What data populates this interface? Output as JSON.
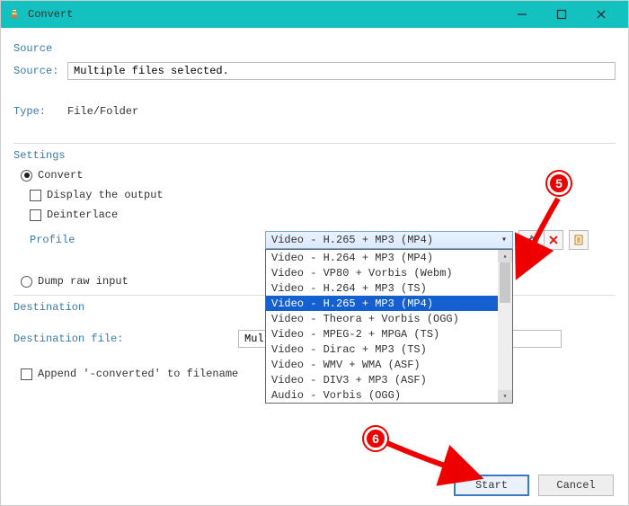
{
  "window": {
    "title": "Convert",
    "min": "—",
    "max": "□",
    "close": "✕"
  },
  "source": {
    "legend": "Source",
    "label": "Source:",
    "value": "Multiple files selected.",
    "type_label": "Type:",
    "type_value": "File/Folder"
  },
  "settings": {
    "legend": "Settings",
    "convert_label": "Convert",
    "display_output": "Display the output",
    "deinterlace": "Deinterlace",
    "profile_label": "Profile",
    "profile_selected": "Video - H.265 + MP3 (MP4)",
    "profile_options": [
      "Video - H.264 + MP3 (MP4)",
      "Video - VP80 + Vorbis (Webm)",
      "Video - H.264 + MP3 (TS)",
      "Video - H.265 + MP3 (MP4)",
      "Video - Theora + Vorbis (OGG)",
      "Video - MPEG-2 + MPGA (TS)",
      "Video - Dirac + MP3 (TS)",
      "Video - WMV + WMA (ASF)",
      "Video - DIV3 + MP3 (ASF)",
      "Audio - Vorbis (OGG)"
    ],
    "dump_label": "Dump raw input"
  },
  "destination": {
    "legend": "Destination",
    "file_label": "Destination file:",
    "file_value": "Multiple Fil",
    "append_label": "Append '-converted' to filename"
  },
  "footer": {
    "start": "Start",
    "cancel": "Cancel"
  },
  "annotations": {
    "badge5": "5",
    "badge6": "6"
  }
}
